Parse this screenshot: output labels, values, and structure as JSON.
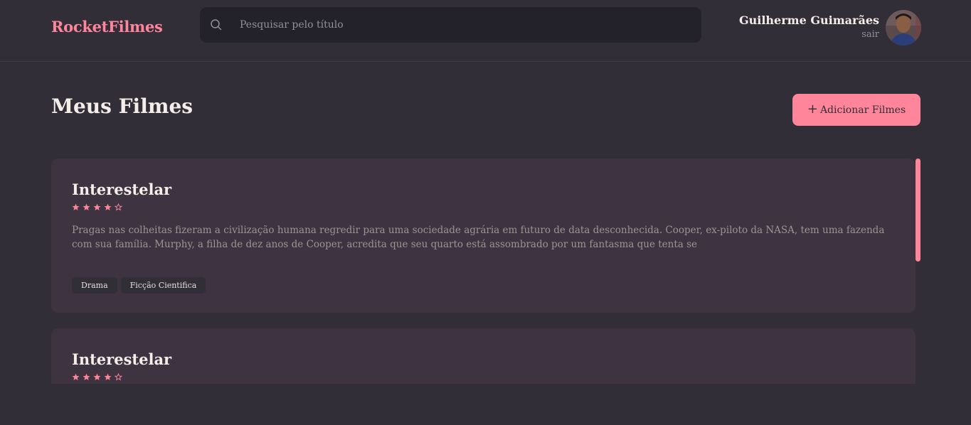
{
  "header": {
    "logo": "RocketFilmes",
    "search_placeholder": "Pesquisar pelo título",
    "user_name": "Guilherme Guimarães",
    "logout_label": "sair"
  },
  "main": {
    "title": "Meus Filmes",
    "add_button_icon": "plus-icon",
    "add_button_label": "Adicionar Filmes"
  },
  "movies": [
    {
      "title": "Interestelar",
      "rating": 4,
      "max_rating": 5,
      "description": "Pragas nas colheitas fizeram a civilização humana regredir para uma sociedade agrária em futuro de data desconhecida. Cooper, ex-piloto da NASA, tem uma fazenda com sua família. Murphy, a filha de dez anos de Cooper, acredita que seu quarto está assombrado por um fantasma que tenta se",
      "tags": [
        "Drama",
        "Ficção Cientifica"
      ]
    },
    {
      "title": "Interestelar",
      "rating": 4,
      "max_rating": 5
    }
  ],
  "colors": {
    "accent": "#FF859B",
    "background": "#312E38",
    "card": "#3E3441",
    "input": "#232129"
  }
}
